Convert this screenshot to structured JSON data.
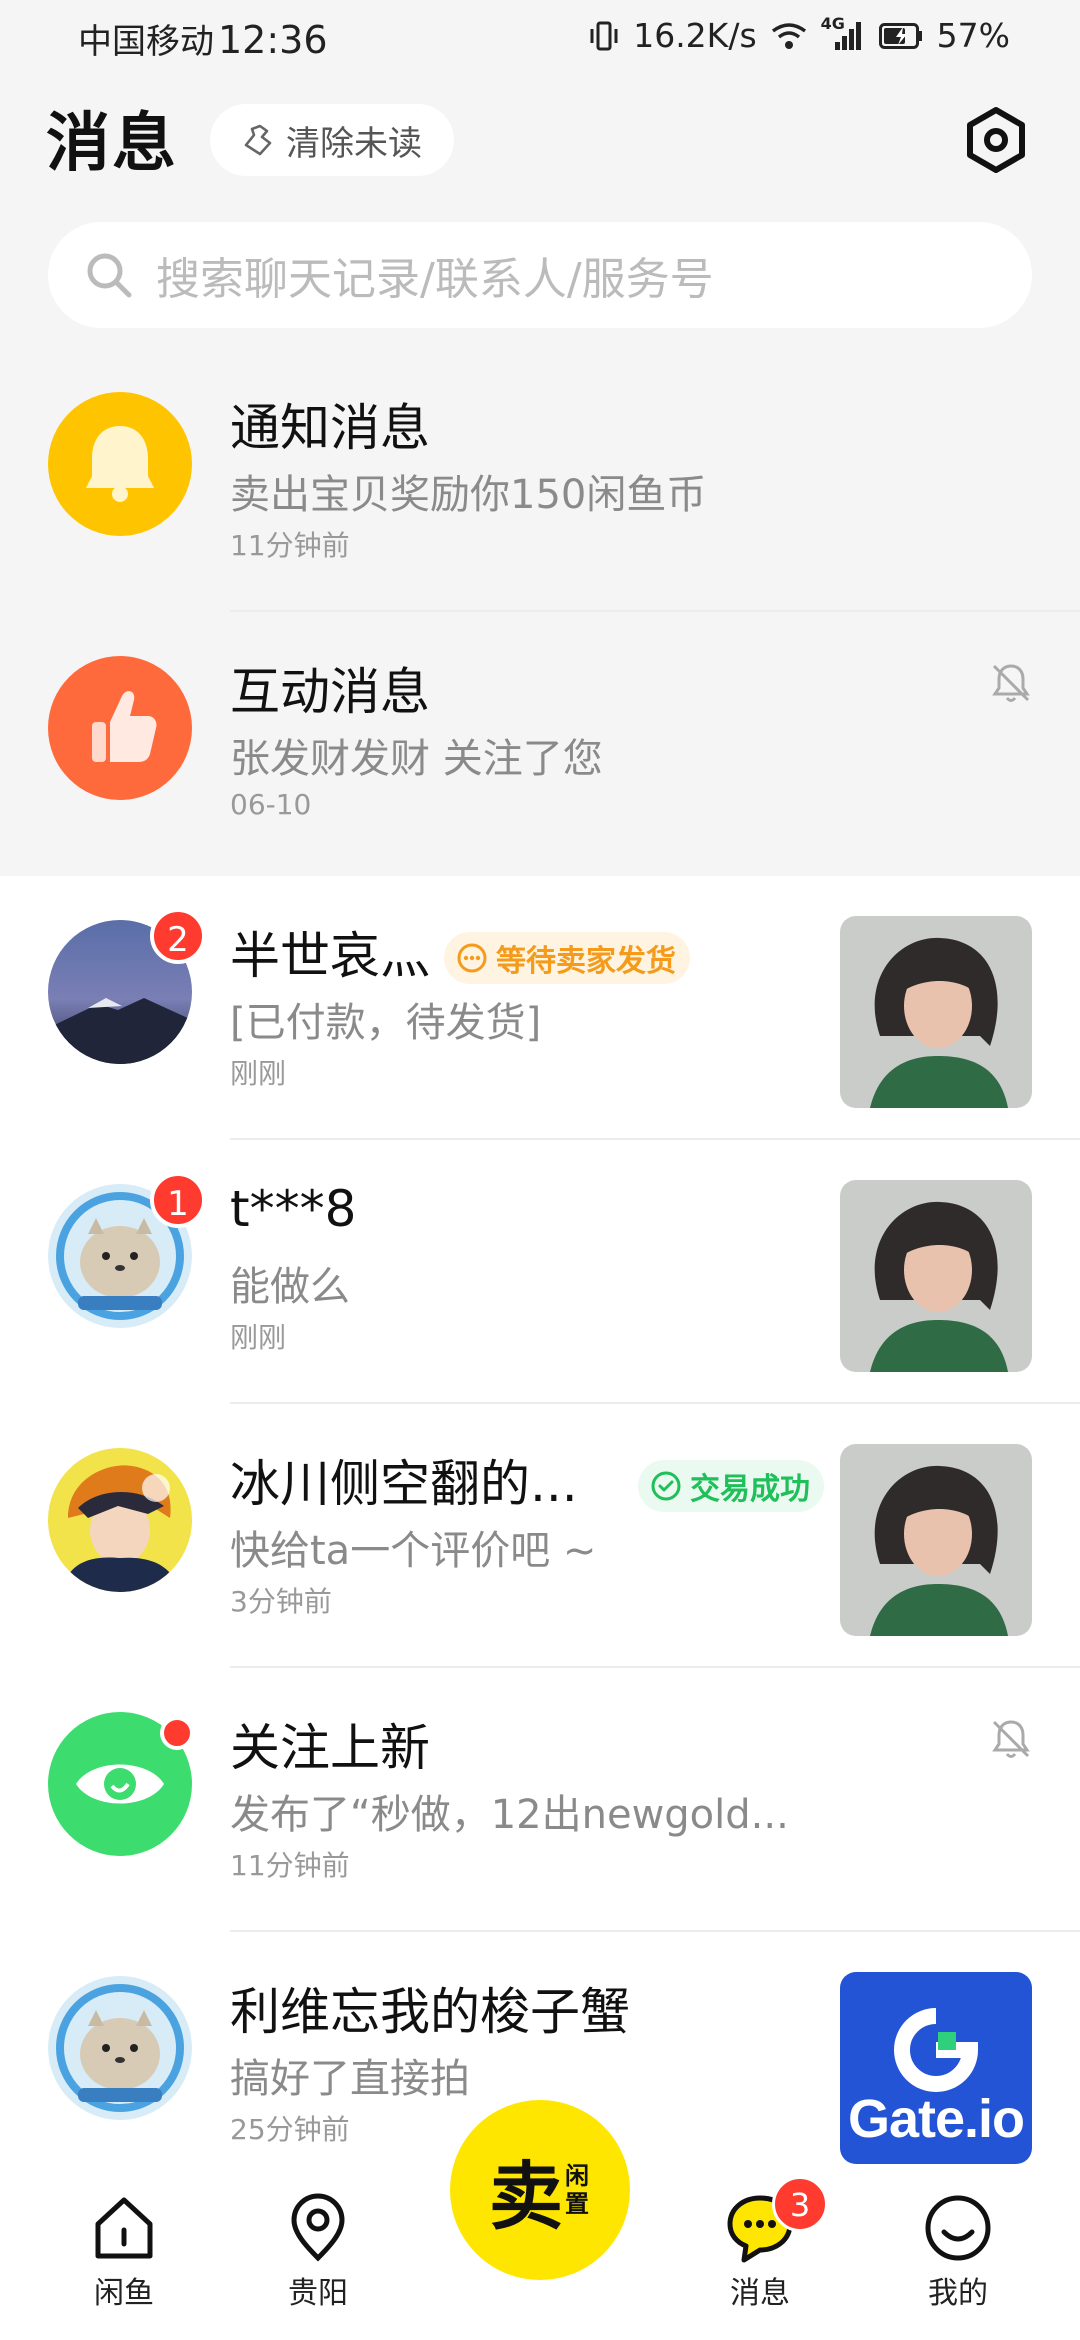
{
  "status_bar": {
    "carrier": "中国移动",
    "time": "12:36",
    "network_speed": "16.2K/s",
    "signal_type": "4G",
    "battery": "57%"
  },
  "header": {
    "title": "消息",
    "clear_unread_label": "清除未读",
    "settings_icon": "settings-hex-icon"
  },
  "search": {
    "placeholder": "搜索聊天记录/联系人/服务号"
  },
  "conversations": [
    {
      "name": "通知消息",
      "message": "卖出宝贝奖励你150闲鱼币",
      "time": "11分钟前",
      "avatar": "bell-icon",
      "avatar_color": "#ffc400"
    },
    {
      "name": "互动消息",
      "message": "张发财发财 关注了您",
      "time": "06-10",
      "avatar": "thumbs-up-icon",
      "avatar_color": "#ff6a3d",
      "muted": true
    },
    {
      "name": "半世哀灬",
      "tag": "等待卖家发货",
      "message": "[已付款，待发货]",
      "time": "刚刚",
      "badge": "2",
      "avatar": "night-mountain-avatar"
    },
    {
      "name": "t***8",
      "message": "能做么",
      "time": "刚刚",
      "badge": "1",
      "avatar": "seal-astronaut-avatar"
    },
    {
      "name": "冰川侧空翻的...",
      "tag": "交易成功",
      "message": "快给ta一个评价吧 ~",
      "time": "3分钟前",
      "avatar": "anime-avatar"
    },
    {
      "name": "关注上新",
      "message": "发布了“秒做，12出newgold...",
      "time": "11分钟前",
      "avatar": "eye-icon",
      "avatar_color": "#3ddc6e",
      "muted": true,
      "dot": true
    },
    {
      "name": "利维忘我的梭子蟹",
      "message": "搞好了直接拍",
      "time": "25分钟前",
      "avatar": "seal-astronaut-avatar",
      "thumb_text": "Gate.io"
    }
  ],
  "nav": {
    "items": [
      {
        "label": "闲鱼",
        "icon": "home-icon"
      },
      {
        "label": "贵阳",
        "icon": "location-icon"
      },
      {
        "label": "消息",
        "icon": "chat-icon",
        "badge": "3"
      },
      {
        "label": "我的",
        "icon": "smile-icon"
      }
    ],
    "sell_big": "卖",
    "sell_small": "闲置"
  },
  "colors": {
    "accent_yellow": "#ffe600",
    "badge_red": "#ff3b30",
    "tag_orange": "#f59b1c",
    "tag_green": "#1fbf5a"
  }
}
